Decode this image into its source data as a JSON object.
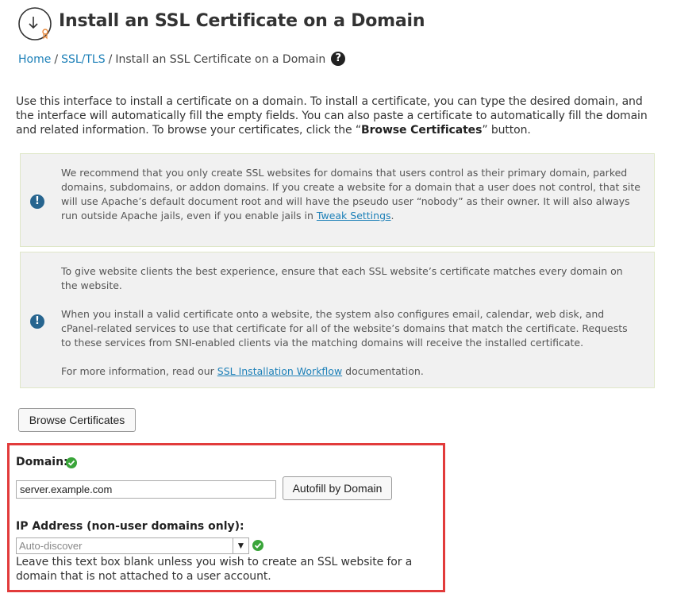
{
  "header": {
    "title": "Install an SSL Certificate on a Domain",
    "icon": "download-certificate-icon"
  },
  "breadcrumb": {
    "items": [
      {
        "label": "Home"
      },
      {
        "label": "SSL/TLS"
      }
    ],
    "current": "Install an SSL Certificate on a Domain",
    "separator": "/",
    "help_icon": "?"
  },
  "intro": {
    "text_before": "Use this interface to install a certificate on a domain. To install a certificate, you can type the desired domain, and the interface will automatically fill the empty fields. You can also paste a certificate to automatically fill the domain and related information. To browse your certificates, click the “",
    "bold": "Browse Certificates",
    "text_after": "” button."
  },
  "notices": [
    {
      "icon": "!",
      "text_before": "We recommend that you only create SSL websites for domains that users control as their primary domain, parked domains, subdomains, or addon domains. If you create a website for a domain that a user does not control, that site will use Apache’s default document root and will have the pseudo user “nobody” as their owner. It will also always run outside Apache jails, even if you enable jails in ",
      "link": "Tweak Settings",
      "text_after": "."
    },
    {
      "icon": "!",
      "para1": "To give website clients the best experience, ensure that each SSL website’s certificate matches every domain on the website.",
      "para2": "When you install a valid certificate onto a website, the system also configures email, calendar, web disk, and cPanel-related services to use that certificate for all of the website’s domains that match the certificate. Requests to these services from SNI-enabled clients via the matching domains will receive the installed certificate.",
      "para3_before": "For more information, read our ",
      "link": "SSL Installation Workflow",
      "para3_after": " documentation."
    }
  ],
  "form": {
    "browse_button": "Browse Certificates",
    "domain_label": "Domain:",
    "domain_value": "server.example.com",
    "autofill_button": "Autofill by Domain",
    "ip_label": "IP Address (non-user domains only):",
    "ip_selected": "Auto-discover",
    "ip_arrow": "▼",
    "ip_hint": "Leave this text box blank unless you wish to create an SSL website for a domain that is not attached to a user account.",
    "highlight_color": "#e23b3b",
    "ok_color": "#3aa53a",
    "link_color": "#1d80b8"
  }
}
